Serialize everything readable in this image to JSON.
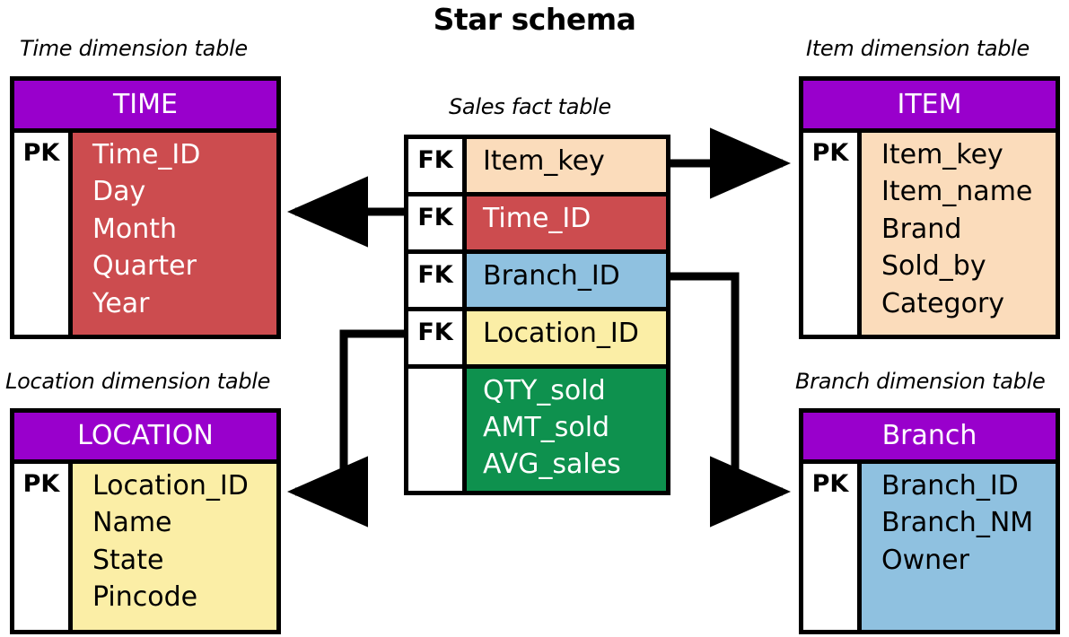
{
  "title": "Star schema",
  "colors": {
    "header_purple": "#9900CC",
    "time_red": "#CC4C4F",
    "item_peach": "#FBDCBB",
    "location_yellow": "#FBEEA6",
    "branch_blue": "#8FC1E0",
    "measures_green": "#0E914E",
    "outline_black": "#000000",
    "background_white": "#FFFFFF"
  },
  "captions": {
    "time": "Time dimension table",
    "item": "Item dimension table",
    "fact": "Sales fact table",
    "location": "Location dimension table",
    "branch": "Branch dimension table"
  },
  "tables": {
    "time": {
      "name": "TIME",
      "key_label": "PK",
      "fields": [
        "Time_ID",
        "Day",
        "Month",
        "Quarter",
        "Year"
      ]
    },
    "item": {
      "name": "ITEM",
      "key_label": "PK",
      "fields": [
        "Item_key",
        "Item_name",
        "Brand",
        "Sold_by",
        "Category"
      ]
    },
    "location": {
      "name": "LOCATION",
      "key_label": "PK",
      "fields": [
        "Location_ID",
        "Name",
        "State",
        "Pincode"
      ]
    },
    "branch": {
      "name": "Branch",
      "key_label": "PK",
      "fields": [
        "Branch_ID",
        "Branch_NM",
        "Owner"
      ]
    }
  },
  "fact_table": {
    "rows": [
      {
        "key_label": "FK",
        "fields": [
          "Item_key"
        ]
      },
      {
        "key_label": "FK",
        "fields": [
          "Time_ID"
        ]
      },
      {
        "key_label": "FK",
        "fields": [
          "Branch_ID"
        ]
      },
      {
        "key_label": "FK",
        "fields": [
          "Location_ID"
        ]
      },
      {
        "key_label": "",
        "fields": [
          "QTY_sold",
          "AMT_sold",
          "AVG_sales"
        ]
      }
    ]
  },
  "relationships": [
    {
      "from": "fact.Item_key",
      "to": "item.Item_key",
      "direction": "right"
    },
    {
      "from": "fact.Time_ID",
      "to": "time.Time_ID",
      "direction": "left"
    },
    {
      "from": "fact.Branch_ID",
      "to": "branch.Branch_ID",
      "direction": "right"
    },
    {
      "from": "fact.Location_ID",
      "to": "location.Location_ID",
      "direction": "left"
    }
  ]
}
